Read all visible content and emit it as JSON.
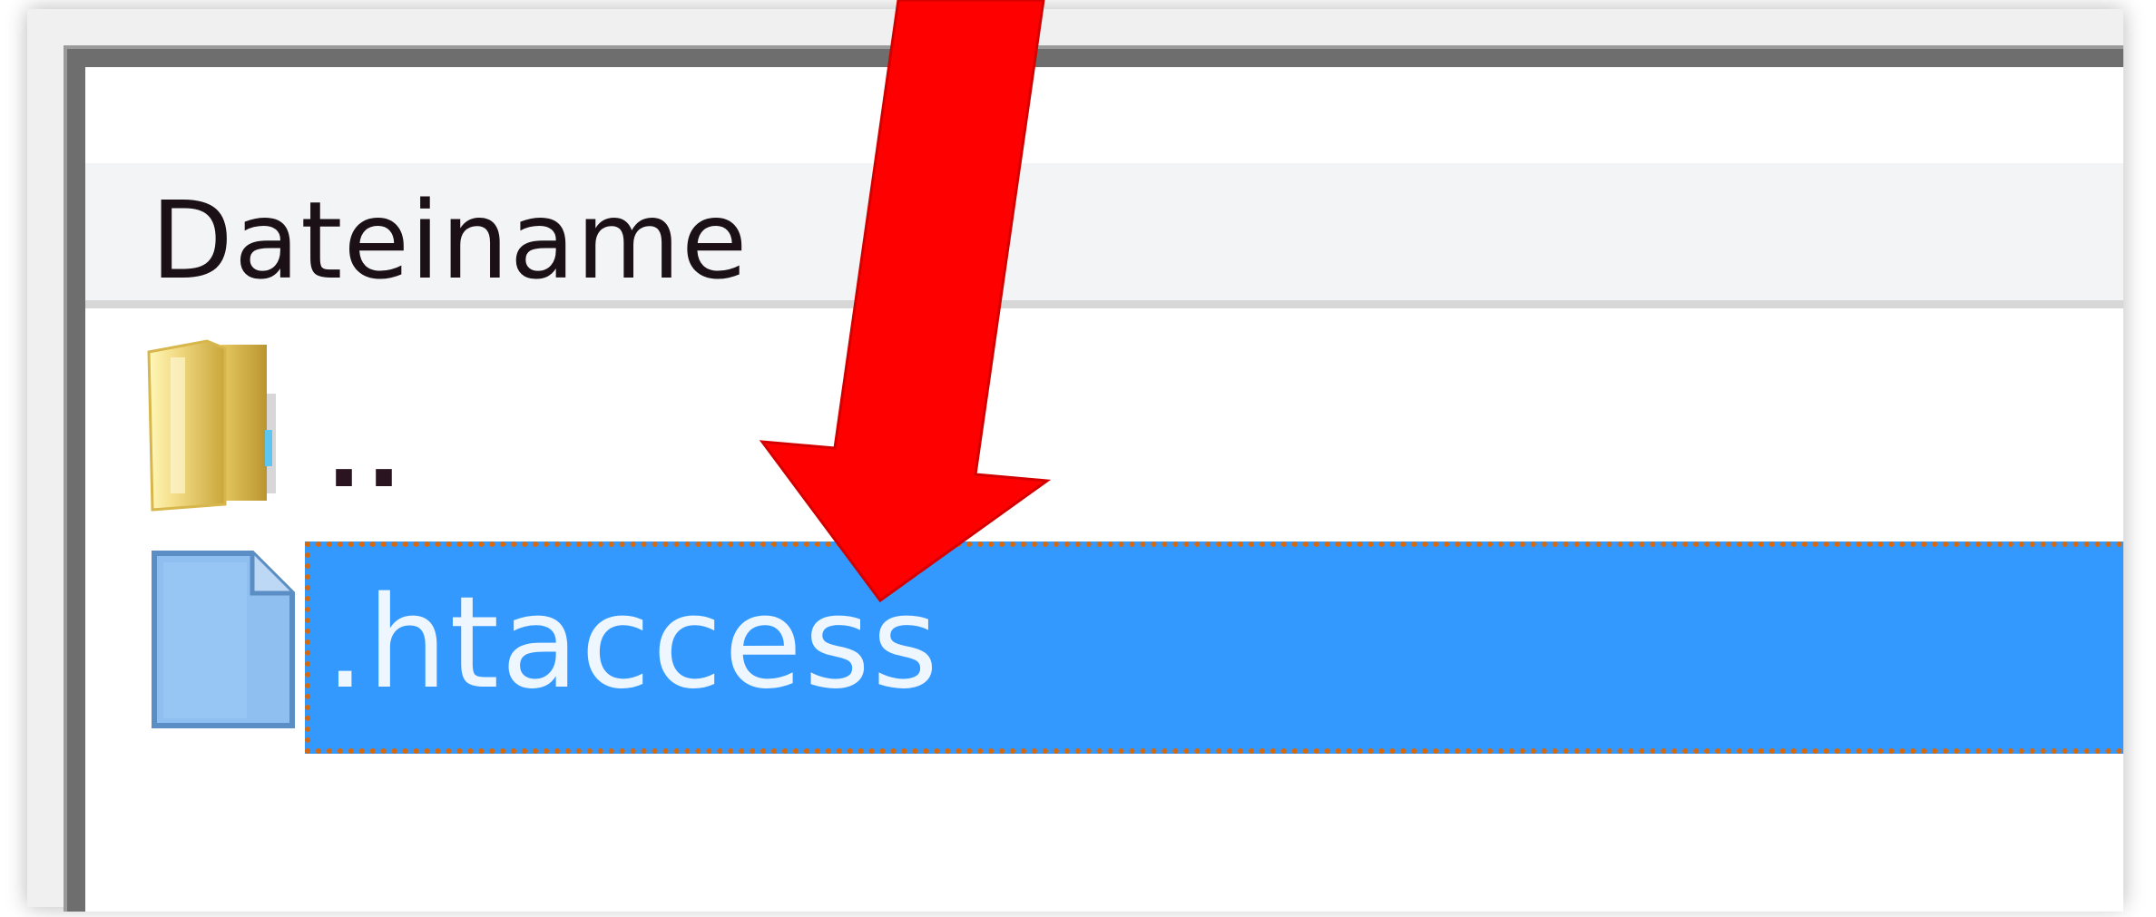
{
  "file_list": {
    "column_header": "Dateiname",
    "rows": [
      {
        "icon": "folder-up-icon",
        "label": ".."
      },
      {
        "icon": "file-icon",
        "label": ".htaccess",
        "selected": true
      }
    ]
  },
  "annotation": {
    "icon": "red-arrow-icon",
    "color": "#ff0000"
  },
  "colors": {
    "selection": "#3399ff",
    "selection_focus_border": "#d6690e",
    "header_background": "#f3f4f6"
  }
}
